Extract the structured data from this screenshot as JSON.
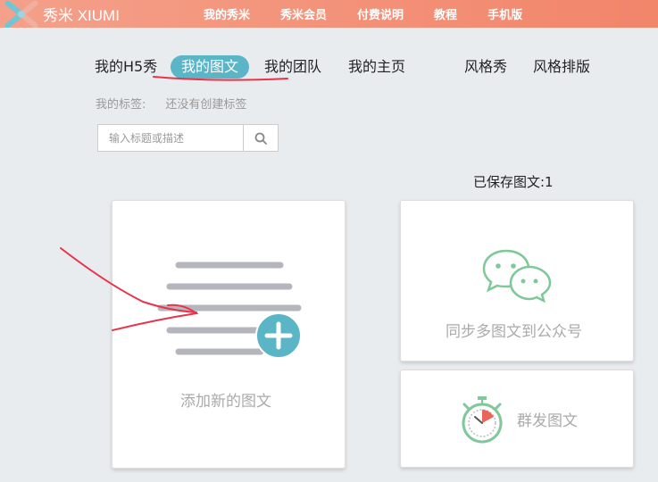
{
  "app": {
    "logo_text": "秀米 XIUMI"
  },
  "topnav": [
    "我的秀米",
    "秀米会员",
    "付费说明",
    "教程",
    "手机版"
  ],
  "subnav": {
    "tabs": [
      "我的H5秀",
      "我的图文",
      "我的团队",
      "我的主页",
      "风格秀",
      "风格排版"
    ],
    "active_index": 1
  },
  "tags": {
    "label": "我的标签:",
    "value": "还没有创建标签"
  },
  "search": {
    "placeholder": "输入标题或描述"
  },
  "saved_count": "已保存图文:1",
  "cards": {
    "add": "添加新的图文",
    "sync": "同步多图文到公众号",
    "mass": "群发图文"
  },
  "colors": {
    "topbar_start": "#f4a08a",
    "topbar_end": "#f2856a",
    "accent": "#5ab5c7",
    "wechat_green": "#7fc89a",
    "annotation_red": "#e8344a"
  },
  "icons": [
    "xiumi-logo-icon",
    "search-icon",
    "document-add-icon",
    "plus-circle-icon",
    "wechat-icon",
    "timer-icon"
  ]
}
